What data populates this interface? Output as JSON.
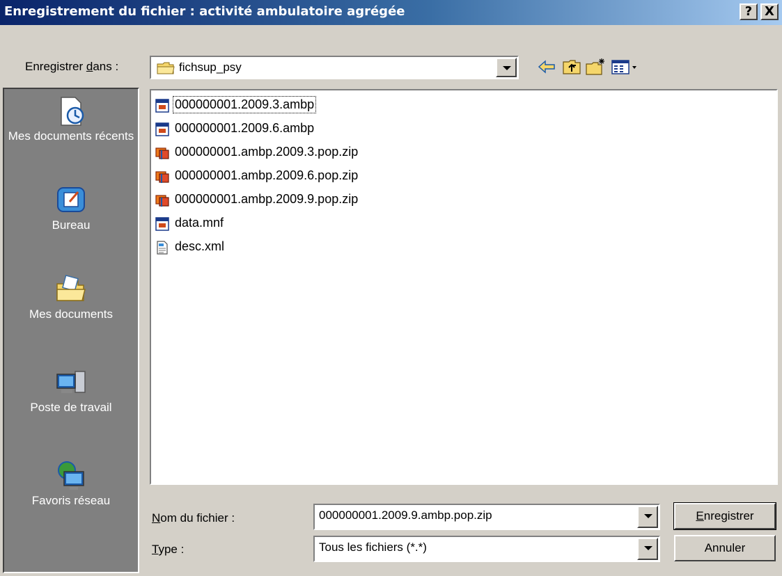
{
  "window": {
    "title": "Enregistrement du fichier : activité ambulatoire agrégée",
    "help_label": "?",
    "close_label": "X"
  },
  "location": {
    "label_prefix": "Enregistrer ",
    "label_accel": "d",
    "label_suffix": "ans :",
    "current": "fichsup_psy"
  },
  "toolbar": {
    "back": "back-arrow-icon",
    "up": "up-folder-icon",
    "new_folder": "new-folder-icon",
    "view_menu": "view-menu-icon"
  },
  "places": [
    {
      "label": "Mes documents récents",
      "icon": "recent-documents-icon"
    },
    {
      "label": "Bureau",
      "icon": "desktop-icon"
    },
    {
      "label": "Mes documents",
      "icon": "my-documents-icon"
    },
    {
      "label": "Poste de travail",
      "icon": "my-computer-icon"
    },
    {
      "label": "Favoris réseau",
      "icon": "network-places-icon"
    }
  ],
  "files": [
    {
      "name": "000000001.2009.3.ambp",
      "icon": "ambp-file-icon",
      "selected": true
    },
    {
      "name": "000000001.2009.6.ambp",
      "icon": "ambp-file-icon",
      "selected": false
    },
    {
      "name": "000000001.ambp.2009.3.pop.zip",
      "icon": "zip-archive-icon",
      "selected": false
    },
    {
      "name": "000000001.ambp.2009.6.pop.zip",
      "icon": "zip-archive-icon",
      "selected": false
    },
    {
      "name": "000000001.ambp.2009.9.pop.zip",
      "icon": "zip-archive-icon",
      "selected": false
    },
    {
      "name": "data.mnf",
      "icon": "ambp-file-icon",
      "selected": false
    },
    {
      "name": "desc.xml",
      "icon": "xml-file-icon",
      "selected": false
    }
  ],
  "filename": {
    "label_accel": "N",
    "label_rest": "om du fichier :",
    "value": "000000001.2009.9.ambp.pop.zip"
  },
  "filetype": {
    "label_accel": "T",
    "label_rest": "ype :",
    "value": "Tous les fichiers (*.*)"
  },
  "buttons": {
    "save_accel": "E",
    "save_rest": "nregistrer",
    "cancel": "Annuler"
  },
  "colors": {
    "title_start": "#0a246a",
    "title_end": "#a6caf0",
    "face": "#d4d0c8",
    "places_bar": "#808080"
  }
}
